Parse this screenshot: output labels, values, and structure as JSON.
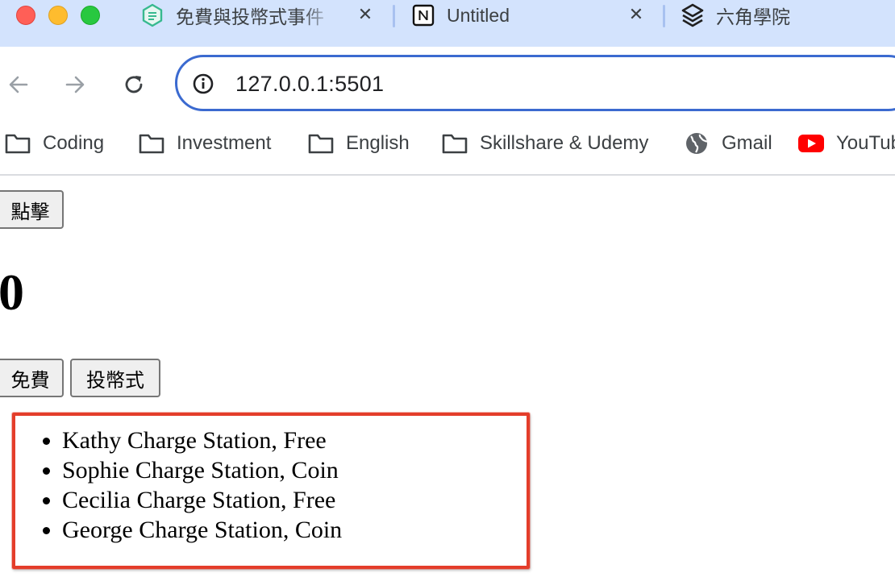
{
  "browser": {
    "tabs": [
      {
        "title": "免費與投幣式事件",
        "close": "✕"
      },
      {
        "title": "Untitled",
        "close": "✕"
      },
      {
        "title": "六角學院"
      }
    ],
    "address_bar": {
      "url": "127.0.0.1:5501"
    },
    "bookmarks": [
      {
        "label": "Coding",
        "icon": "folder-icon"
      },
      {
        "label": "Investment",
        "icon": "folder-icon"
      },
      {
        "label": "English",
        "icon": "folder-icon"
      },
      {
        "label": "Skillshare & Udemy",
        "icon": "folder-icon"
      },
      {
        "label": "Gmail",
        "icon": "globe-icon"
      },
      {
        "label": "YouTube",
        "icon": "youtube-icon"
      }
    ],
    "colors": {
      "tabstrip": "#d3e3fd",
      "omnibox_border": "#3b6ad0",
      "highlight_box": "#e43d2a"
    }
  },
  "page": {
    "click_button": "點擊",
    "counter": "0",
    "filter_buttons": {
      "free": "免費",
      "coin": "投幣式"
    },
    "stations": [
      "Kathy Charge Station, Free",
      "Sophie Charge Station, Coin",
      "Cecilia Charge Station, Free",
      "George Charge Station, Coin"
    ]
  }
}
